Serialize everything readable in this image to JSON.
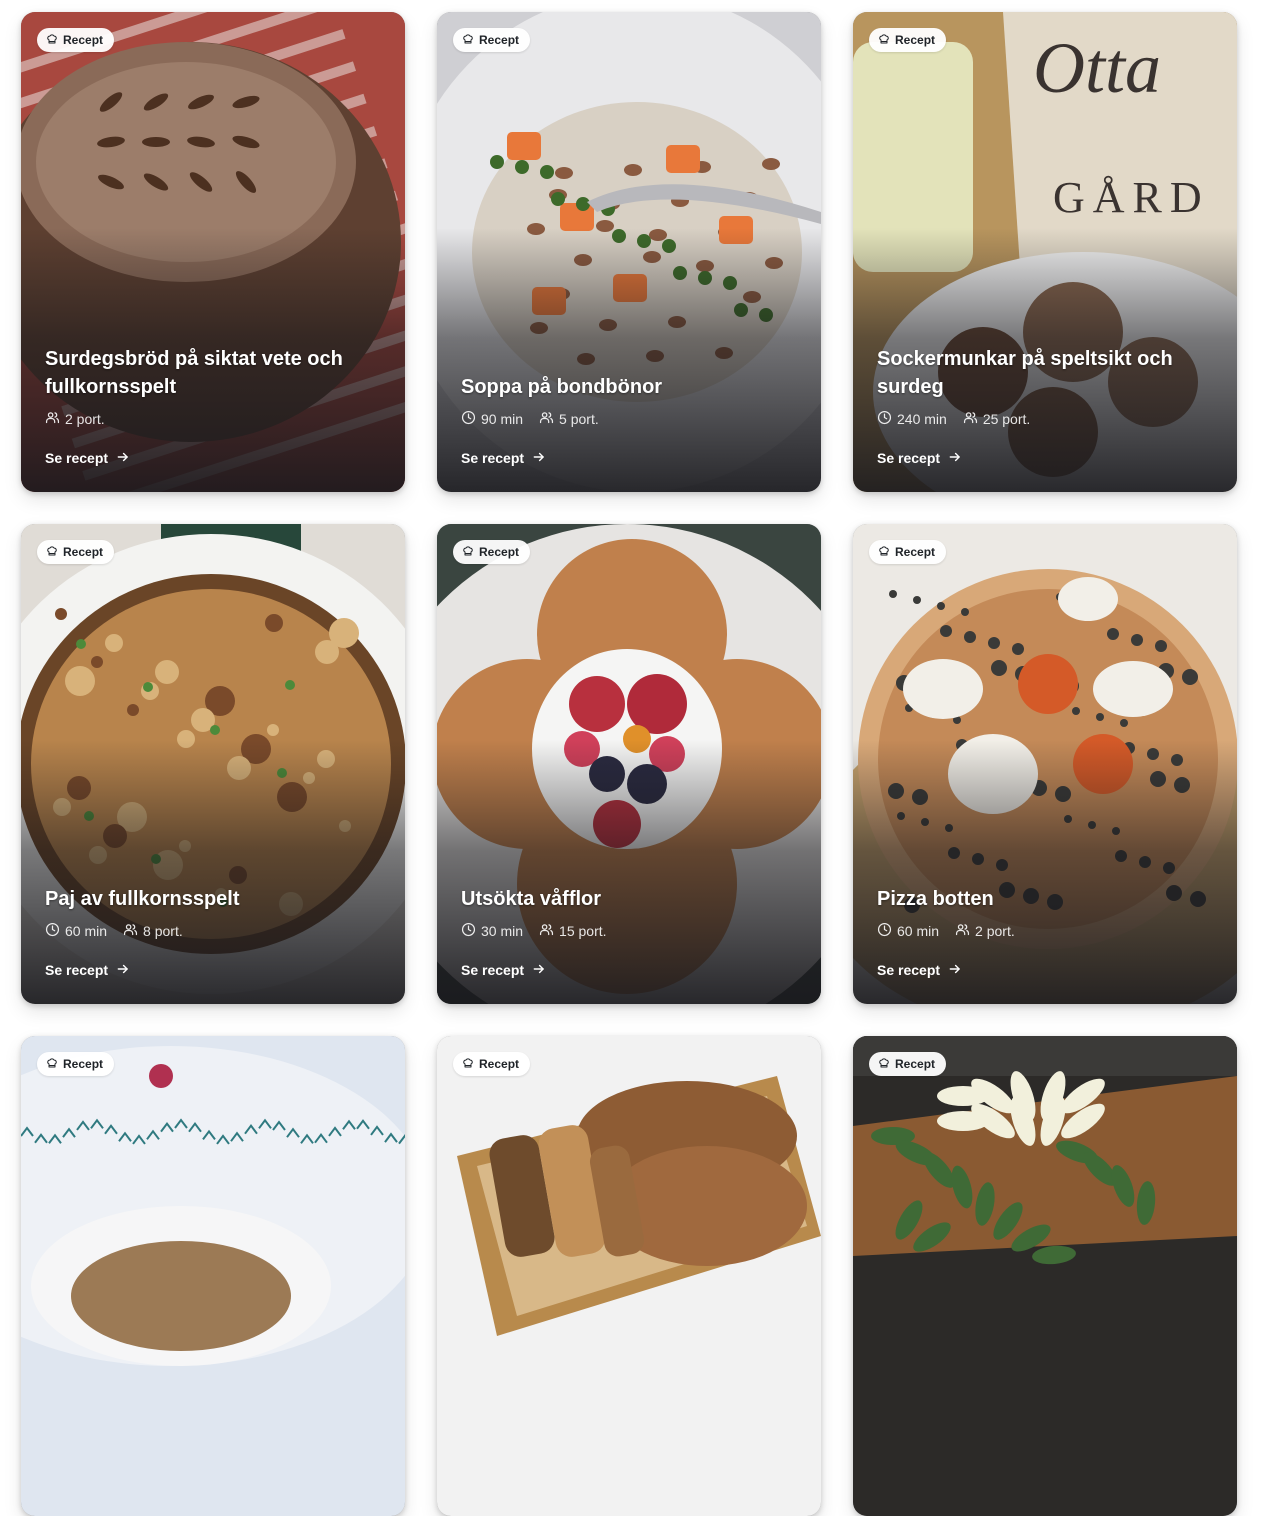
{
  "cards": [
    {
      "badge": "Recept",
      "title": "Surdegsbröd på siktat vete och fullkornsspelt",
      "time": "",
      "portions": "2 port.",
      "cta": "Se recept",
      "photo_icon": "bread-photo",
      "photo_colors": {
        "bg": "#a8483f",
        "main": "#8a6a58",
        "accent": "#5e4031"
      }
    },
    {
      "badge": "Recept",
      "title": "Soppa på bondbönor",
      "time": "90 min",
      "portions": "5 port.",
      "cta": "Se recept",
      "photo_icon": "soup-photo",
      "photo_colors": {
        "bg": "#e8e8ea",
        "main": "#d8d0c4",
        "accent": "#e8783a"
      }
    },
    {
      "badge": "Recept",
      "title": "Sockermunkar på speltsikt och surdeg",
      "time": "240 min",
      "portions": "25 port.",
      "cta": "Se recept",
      "photo_icon": "doughnuts-photo",
      "photo_colors": {
        "bg": "#b8955e",
        "main": "#ddd4c2",
        "accent": "#6b4a36"
      }
    },
    {
      "badge": "Recept",
      "title": "Paj av fullkornsspelt",
      "time": "60 min",
      "portions": "8 port.",
      "cta": "Se recept",
      "photo_icon": "pie-photo",
      "photo_colors": {
        "bg": "#e8e8e6",
        "main": "#b8844c",
        "accent": "#6a4527"
      }
    },
    {
      "badge": "Recept",
      "title": "Utsökta våfflor",
      "time": "30 min",
      "portions": "15 port.",
      "cta": "Se recept",
      "photo_icon": "waffles-photo",
      "photo_colors": {
        "bg": "#e6e4e2",
        "main": "#c0804c",
        "accent": "#b8303e"
      }
    },
    {
      "badge": "Recept",
      "title": "Pizza botten",
      "time": "60 min",
      "portions": "2 port.",
      "cta": "Se recept",
      "photo_icon": "pizza-photo",
      "photo_colors": {
        "bg": "#ece9e4",
        "main": "#c48a58",
        "accent": "#3a3a38"
      }
    },
    {
      "badge": "Recept",
      "title": "",
      "time": "",
      "portions": "",
      "cta": "",
      "photo_icon": "crispbread-photo",
      "photo_colors": {
        "bg": "#dfe6f0",
        "main": "#9c7a55",
        "accent": "#2f7a80"
      }
    },
    {
      "badge": "Recept",
      "title": "",
      "time": "",
      "portions": "",
      "cta": "",
      "photo_icon": "bread-basket-photo",
      "photo_colors": {
        "bg": "#cfc7bf",
        "main": "#a0693e",
        "accent": "#6e4b2c"
      }
    },
    {
      "badge": "Recept",
      "title": "",
      "time": "",
      "portions": "",
      "cta": "",
      "photo_icon": "poinsettia-photo",
      "photo_colors": {
        "bg": "#2c2a28",
        "main": "#f2f0dc",
        "accent": "#3f6a36"
      }
    }
  ],
  "icons": {
    "badge": "chef-hat-icon",
    "time": "clock-icon",
    "portions": "users-icon",
    "cta": "arrow-right-icon"
  }
}
